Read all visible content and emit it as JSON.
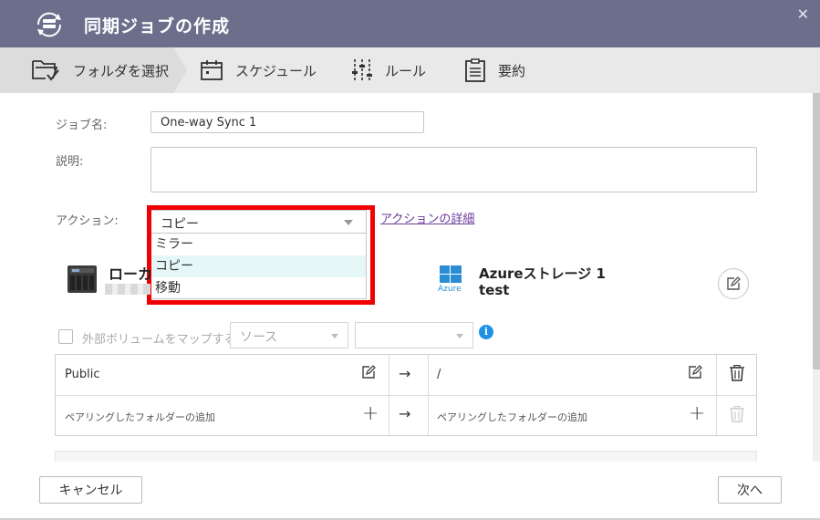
{
  "window": {
    "title": "同期ジョブの作成",
    "close_glyph": "✕"
  },
  "steps": [
    {
      "label": "フォルダを選択",
      "icon": "folder-check-icon",
      "active": true
    },
    {
      "label": "スケジュール",
      "icon": "calendar-icon",
      "active": false
    },
    {
      "label": "ルール",
      "icon": "sliders-icon",
      "active": false
    },
    {
      "label": "要約",
      "icon": "clipboard-icon",
      "active": false
    }
  ],
  "form": {
    "job_name_label": "ジョブ名:",
    "job_name_value": "One-way Sync 1",
    "description_label": "説明:",
    "description_value": "",
    "action_label": "アクション:",
    "action_selected": "コピー",
    "action_options": [
      "ミラー",
      "コピー",
      "移動"
    ],
    "action_details_link": "アクションの詳細"
  },
  "source": {
    "name": "ローカ",
    "icon": "nas-device-icon"
  },
  "destination": {
    "name": "Azureストレージ 1",
    "subtitle": "test",
    "logo_text": "Azure",
    "icon": "windows-azure-icon"
  },
  "external_volume": {
    "label": "外部ボリュームをマップする",
    "source_placeholder": "ソース",
    "second_value": "",
    "checked": false
  },
  "pairs": {
    "rows": [
      {
        "local": "Public",
        "arrow": "→",
        "remote": "/"
      },
      {
        "local": "ペアリングしたフォルダーの追加",
        "arrow": "→",
        "remote": "ペアリングしたフォルダーの追加"
      }
    ],
    "add_glyph": "+"
  },
  "footer": {
    "cancel_label": "キャンセル",
    "next_label": "次へ"
  },
  "colors": {
    "titlebar": "#6b6f8c",
    "highlight_frame": "#f00000",
    "link": "#6b3a9a",
    "info": "#1e90e6",
    "azure": "#2a8dd4"
  }
}
